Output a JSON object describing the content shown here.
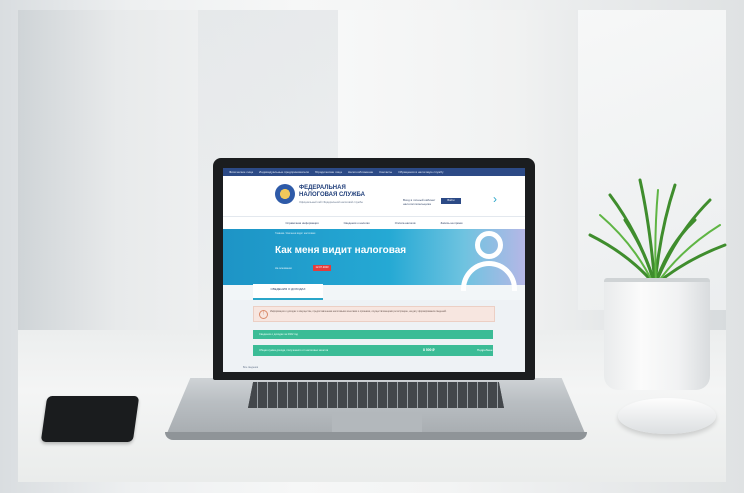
{
  "site": {
    "topbar_items": [
      "Физические лица",
      "Индивидуальные предприниматели",
      "Юридические лица",
      "Налогообложение",
      "Контакты",
      "Обращения в налоговую службу"
    ],
    "brand_line1": "ФЕДЕРАЛЬНАЯ",
    "brand_line2": "НАЛОГОВАЯ СЛУЖБА",
    "brand_sub": "Официальный сайт Федеральной налоговой службы",
    "header_text": "Вход в личный кабинет налогоплательщика",
    "header_button": "Войти",
    "nav_items": [
      "Справочная информация",
      "Сведения о налогах",
      "Оплата налогов",
      "Запись на прием"
    ]
  },
  "hero": {
    "breadcrumb": "Главная / Как меня видит налоговая",
    "title": "Как меня видит налоговая",
    "note": "На основании",
    "badge": "12.07.2023"
  },
  "tab": {
    "label": "СВЕДЕНИЯ О ДОХОДАХ"
  },
  "content": {
    "notice": "Информация о доходах и имуществе, предоставленная налоговыми агентами и органами, осуществляющими регистрацию, на дату формирования сведений.",
    "bar1": "Сведения о доходах за 2022 год",
    "bar2": "Общая сумма дохода, полученного от налоговых агентов",
    "bar2_value": "8 500 ₽",
    "bar2_details": "Подробнее",
    "footer_link": "Все сведения"
  },
  "colors": {
    "site_blue": "#2c4a86",
    "hero_cyan": "#1d94c6",
    "green_bar": "#3bbc96",
    "badge_red": "#e33c3c"
  }
}
